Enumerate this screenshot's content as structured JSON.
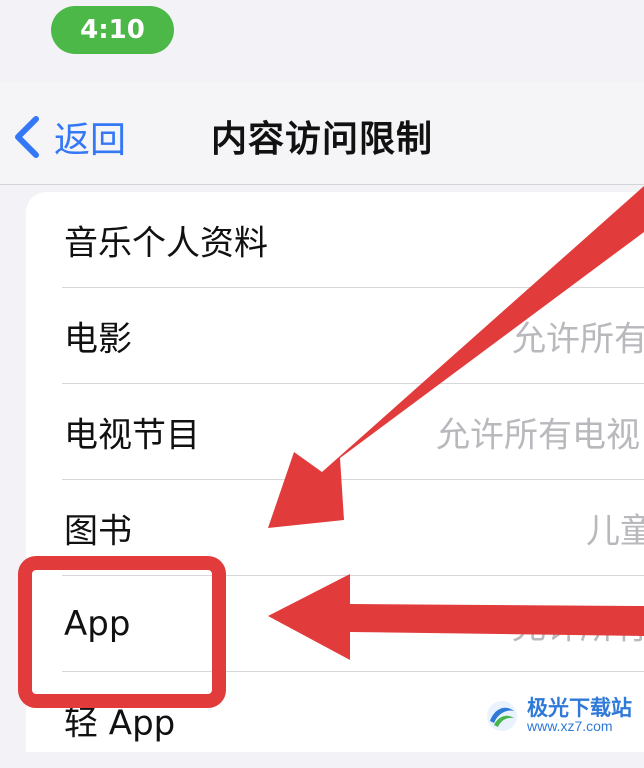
{
  "status_bar": {
    "time": "4:10",
    "time_pill_color": "#4cb848"
  },
  "nav": {
    "back_label": "返回",
    "title": "内容访问限制",
    "accent_color": "#3478f6"
  },
  "list": {
    "rows": [
      {
        "label": "音乐个人资料",
        "value": ""
      },
      {
        "label": "电影",
        "value": "允许所有"
      },
      {
        "label": "电视节目",
        "value": "允许所有电视"
      },
      {
        "label": "图书",
        "value": "儿童"
      },
      {
        "label": "App",
        "value": "允许所有"
      },
      {
        "label": "轻 App",
        "value": ""
      }
    ]
  },
  "annotation": {
    "highlight_color": "#e23b3b",
    "arrows": [
      {
        "icon": "red-arrow-icon"
      },
      {
        "icon": "red-arrow-icon"
      }
    ]
  },
  "watermark": {
    "name": "极光下载站",
    "url": "www.xz7.com",
    "icon": "aurora-logo-icon"
  }
}
